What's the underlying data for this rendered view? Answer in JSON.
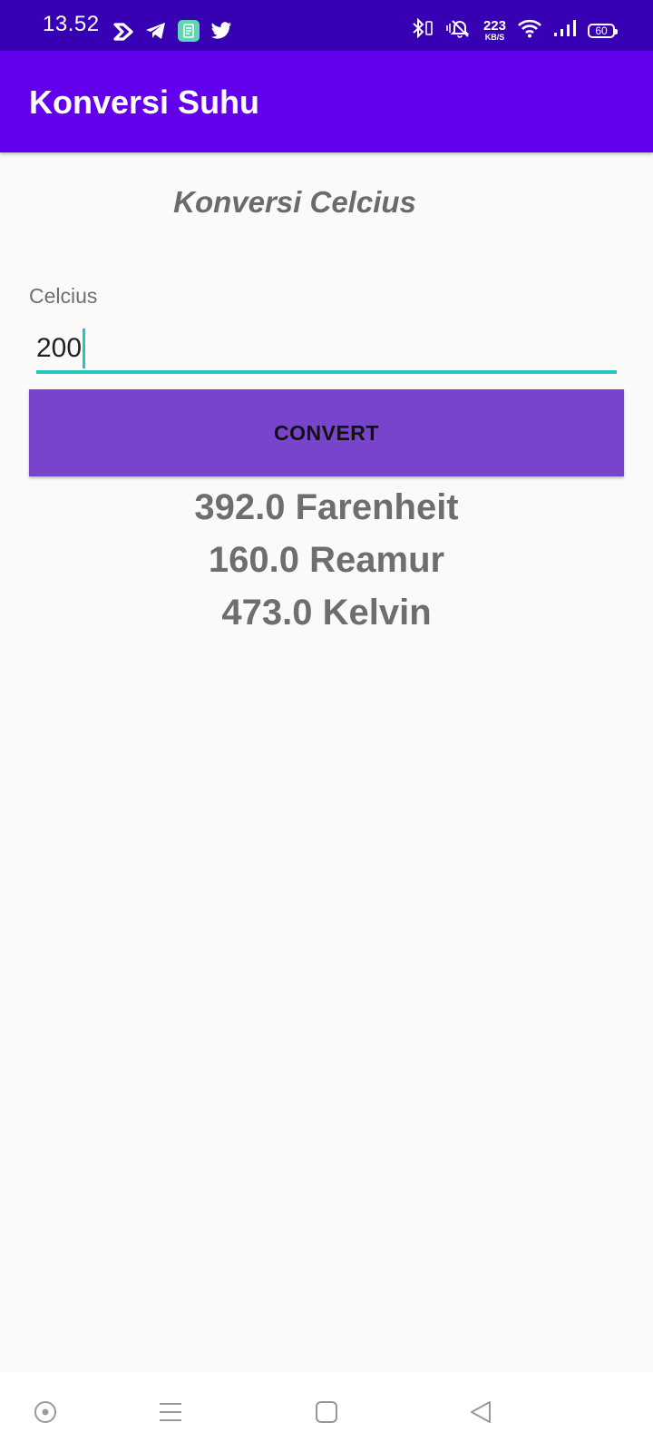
{
  "status_bar": {
    "time": "13.52",
    "net_speed_value": "223",
    "net_speed_unit": "KB/S",
    "battery_level": "60",
    "left_icons": [
      "app-icon",
      "telegram-icon",
      "app-icon-2",
      "twitter-icon"
    ],
    "right_icons": [
      "bluetooth-icon",
      "mute-icon",
      "wifi-icon",
      "signal-icon",
      "battery-icon"
    ]
  },
  "app_bar": {
    "title": "Konversi Suhu"
  },
  "main": {
    "heading": "Konversi Celcius",
    "input_label": "Celcius",
    "input_value": "200",
    "convert_label": "CONVERT",
    "results": [
      "392.0 Farenheit",
      "160.0 Reamur",
      "473.0 Kelvin"
    ]
  },
  "nav_bar": {
    "buttons": [
      "record-icon",
      "menu-icon",
      "home-icon",
      "back-icon"
    ]
  },
  "colors": {
    "status_bar": "#3700b3",
    "app_bar": "#6200ee",
    "button": "#7844cc",
    "accent": "#26c6b8",
    "background": "#fafafa"
  }
}
